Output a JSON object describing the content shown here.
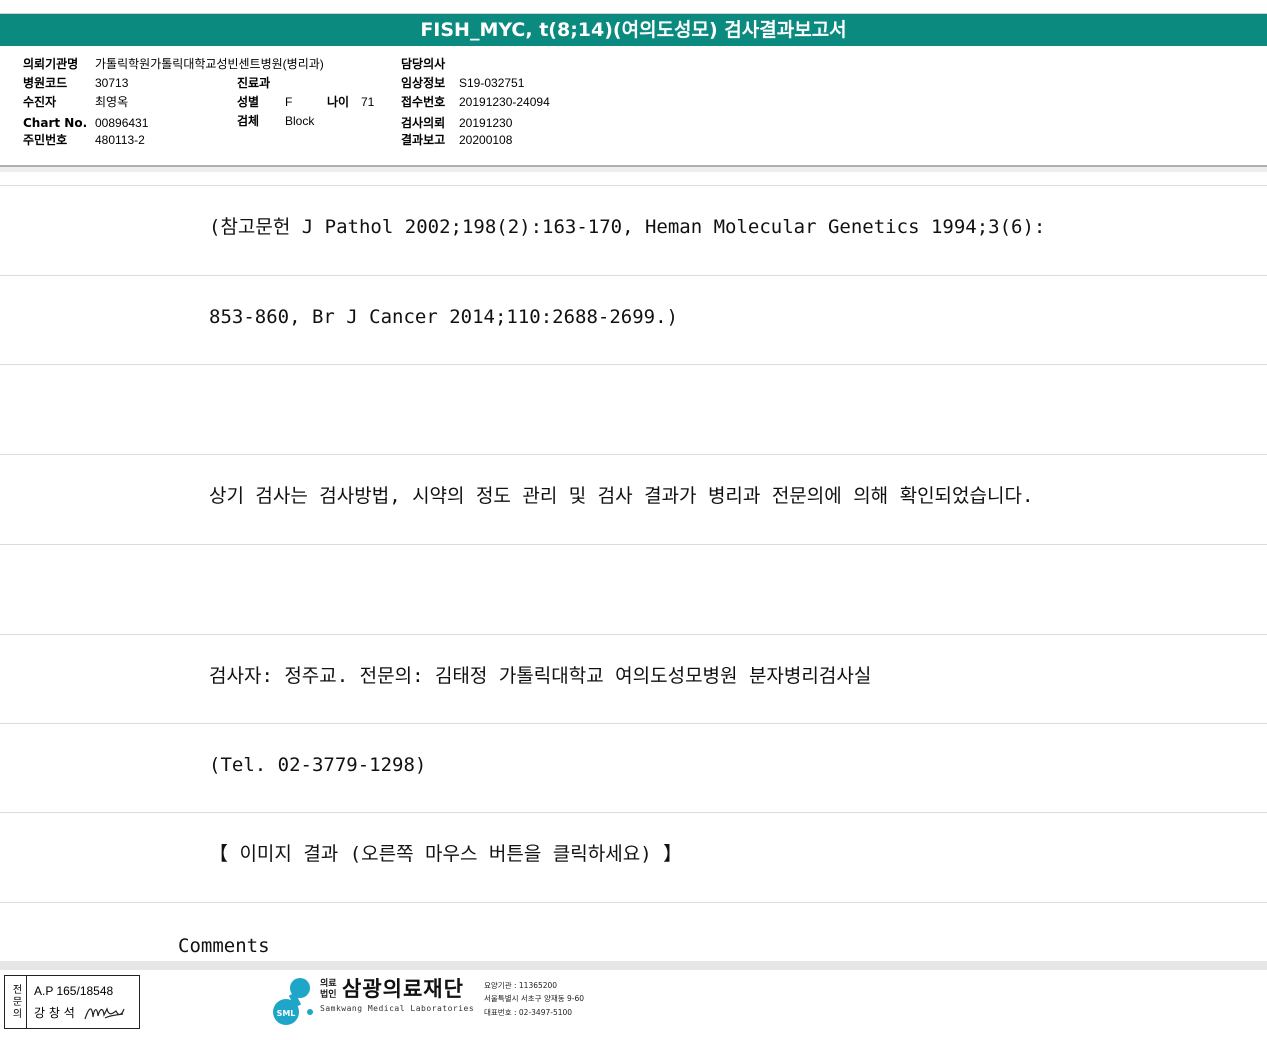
{
  "report": {
    "title": "FISH_MYC, t(8;14)(여의도성모) 검사결과보고서"
  },
  "patient_info": {
    "institution_label": "의뢰기관명",
    "institution_value": "가톨릭학원가톨릭대학교성빈센트병원(병리과)",
    "hospital_code_label": "병원코드",
    "hospital_code_value": "30713",
    "patient_label": "수진자",
    "patient_value": "최영옥",
    "chart_no_label": "Chart No.",
    "chart_no_value": "00896431",
    "resident_no_label": "주민번호",
    "resident_no_value": "480113-2",
    "department_label": "진료과",
    "department_value": "",
    "sex_label": "성별",
    "sex_value": "F",
    "age_label": "나이",
    "age_value": "71",
    "specimen_label": "검체",
    "specimen_value": "Block",
    "doctor_label": "담당의사",
    "doctor_value": "",
    "clinical_info_label": "임상정보",
    "clinical_info_value": "S19-032751",
    "receipt_no_label": "접수번호",
    "receipt_no_value": "20191230-24094",
    "request_date_label": "검사의뢰",
    "request_date_value": "20191230",
    "report_date_label": "결과보고",
    "report_date_value": "20200108"
  },
  "result_lines": [
    "(참고문헌 J Pathol 2002;198(2):163-170, Heman Molecular Genetics 1994;3(6):",
    "853-860, Br J Cancer 2014;110:2688-2699.)",
    "",
    "상기 검사는 검사방법, 시약의 정도 관리 및 검사 결과가 병리과 전문의에 의해 확인되었습니다.",
    "",
    "검사자: 정주교. 전문의: 김태정 가톨릭대학교 여의도성모병원 분자병리검사실",
    "(Tel. 02-3779-1298)",
    "【 이미지 결과 (오른쪽 마우스 버튼을 클릭하세요) 】"
  ],
  "comments_label": "Comments",
  "footer": {
    "stamp_title": "전문의",
    "stamp_license": "A.P 165/18548",
    "stamp_name": "강 창 석",
    "logo_kind": "의료 법인",
    "logo_name": "삼광의료재단",
    "logo_english": "Samkwang Medical Laboratories",
    "logo_badge": "SML",
    "care_institution": "요양기관 : 11365200",
    "address": "서울특별시 서초구 양재동 9-60",
    "phone": "대표번호 : 02-3497-5100"
  }
}
